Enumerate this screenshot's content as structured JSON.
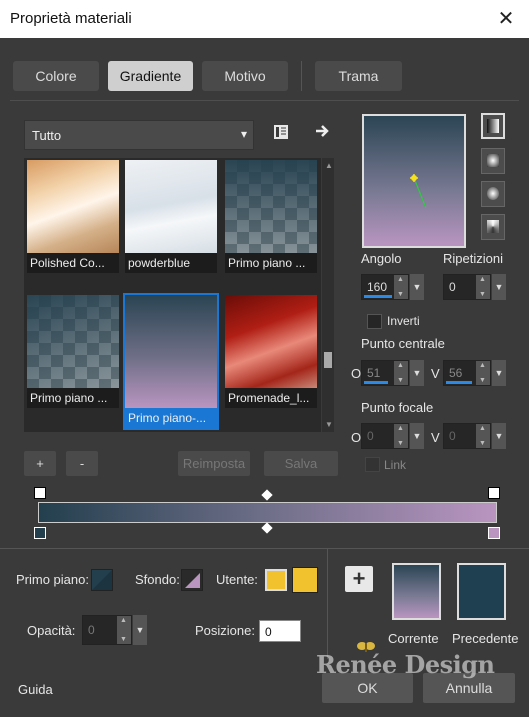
{
  "window": {
    "title": "Proprietà materiali",
    "close": "✕"
  },
  "tabs": [
    "Colore",
    "Gradiente",
    "Motivo",
    "Trama"
  ],
  "library": {
    "selected": "Tutto",
    "dropdown_arrow": "▾",
    "menu_icon": "menu-list-icon",
    "next_icon": "arrow-right-icon"
  },
  "thumbnails": [
    {
      "label": "Polished Co..."
    },
    {
      "label": "powderblue"
    },
    {
      "label": "Primo piano ..."
    },
    {
      "label": "Primo piano ..."
    },
    {
      "label": "Primo piano-..."
    },
    {
      "label": "Promenade_l..."
    }
  ],
  "buttons": {
    "add": "+",
    "remove": "-",
    "reset": "Reimposta",
    "save": "Salva"
  },
  "gradient": {
    "fg_color": "#233f4e",
    "bg_color": "#b995c0"
  },
  "params": {
    "angle_label": "Angolo",
    "angle_value": "160",
    "repeat_label": "Ripetizioni",
    "repeat_value": "0",
    "invert_label": "Inverti",
    "center_label": "Punto centrale",
    "center_h": "O",
    "center_h_value": "51",
    "center_v": "V",
    "center_v_value": "56",
    "focus_label": "Punto focale",
    "focus_h": "O",
    "focus_h_value": "0",
    "focus_v": "V",
    "focus_v_value": "0",
    "link_label": "Link"
  },
  "bottom": {
    "fg_label": "Primo piano:",
    "bg_label": "Sfondo:",
    "user_label": "Utente:",
    "user_color": "#f2c12e",
    "opacity_label": "Opacità:",
    "opacity_value": "0",
    "position_label": "Posizione:",
    "position_value": "0",
    "current_label": "Corrente",
    "previous_label": "Precedente",
    "add_swatch": "+",
    "previous_color": "#1f4050",
    "watermark": "Renée Design"
  },
  "footer": {
    "help": "Guida",
    "ok": "OK",
    "cancel": "Annulla"
  }
}
